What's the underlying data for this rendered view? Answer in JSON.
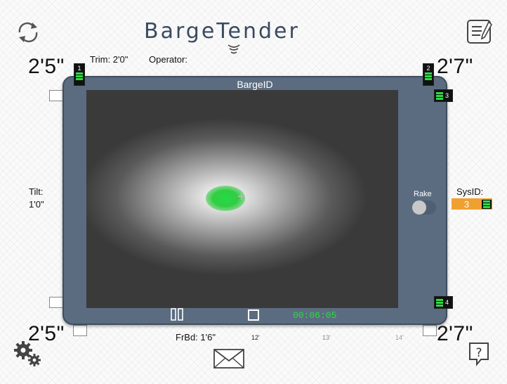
{
  "header": {
    "logo_text": "BargeTender",
    "refresh_icon": "refresh-icon",
    "notes_icon": "notepad-icon"
  },
  "measurements": {
    "top_left": "2'5\"",
    "top_right": "2'7\"",
    "bottom_left": "2'5\"",
    "bottom_right": "2'7\""
  },
  "info": {
    "trim_label": "Trim:",
    "trim_value": "2'0\"",
    "operator_label": "Operator:",
    "tilt_label": "Tilt:",
    "tilt_value": "1'0\"",
    "frbd_label": "FrBd:",
    "frbd_value": "1'6\"",
    "sysid_label": "SysID:",
    "sysid_value": "3"
  },
  "barge": {
    "id_label": "BargeID",
    "rake_label": "Rake",
    "rake_on": false
  },
  "sensors": [
    {
      "num": "1",
      "level": 3
    },
    {
      "num": "2",
      "level": 3
    },
    {
      "num": "3",
      "level": 3
    },
    {
      "num": "4",
      "level": 3
    }
  ],
  "playback": {
    "timer": "00:06:05"
  },
  "depth_ticks": [
    "12'",
    "13'",
    "14'"
  ],
  "footer": {
    "settings_icon": "gear-icon",
    "mail_icon": "mail-icon",
    "help_icon": "help-icon"
  },
  "colors": {
    "accent_orange": "#f0a030",
    "battery_green": "#2bdc43",
    "frame": "#5b6c80"
  }
}
